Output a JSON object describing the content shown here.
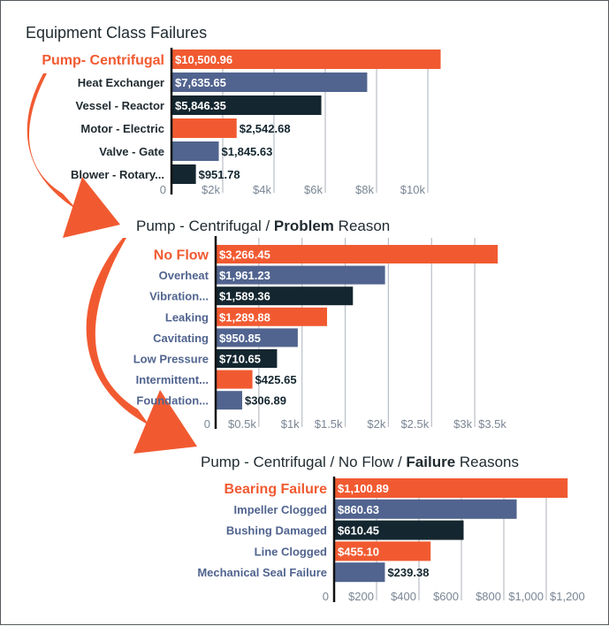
{
  "colors": {
    "orange": "#f15a31",
    "slate": "#51648f",
    "navy": "#14262f",
    "grid": "#b9bec6",
    "axis": "#111111",
    "tick_text": "#7a8694",
    "label_dark": "#1f2a30",
    "label_slate": "#51648f",
    "arrow": "#f15a31"
  },
  "chart_data": [
    {
      "type": "bar",
      "orientation": "horizontal",
      "title": "Equipment Class Failures",
      "title_parts": [
        {
          "text": "Equipment Class Failures",
          "bold": false
        }
      ],
      "categories": [
        "Pump- Centrifugal",
        "Heat Exchanger",
        "Vessel - Reactor",
        "Motor - Electric",
        "Valve - Gate",
        "Blower - Rotary..."
      ],
      "values": [
        10500.96,
        7635.65,
        5846.35,
        2542.68,
        1845.63,
        951.78
      ],
      "value_labels": [
        "$10,500.96",
        "$7,635.65",
        "$5,846.35",
        "$2,542.68",
        "$1,845.63",
        "$951.78"
      ],
      "bar_colors": [
        "orange",
        "slate",
        "navy",
        "orange",
        "slate",
        "navy"
      ],
      "highlight_index": 0,
      "label_color": "label_dark",
      "xlim": [
        0,
        10000
      ],
      "xticks": [
        0,
        2000,
        4000,
        6000,
        8000,
        10000
      ],
      "xtick_labels": [
        "0",
        "$2k",
        "$4k",
        "$6k",
        "$8k",
        "$10k"
      ],
      "grid": true,
      "xlabel": "",
      "ylabel": ""
    },
    {
      "type": "bar",
      "orientation": "horizontal",
      "title": "Pump - Centrifugal / Problem Reason",
      "title_parts": [
        {
          "text": "Pump - Centrifugal / ",
          "bold": false
        },
        {
          "text": "Problem",
          "bold": true
        },
        {
          "text": " Reason",
          "bold": false
        }
      ],
      "categories": [
        "No Flow",
        "Overheat",
        "Vibration...",
        "Leaking",
        "Cavitating",
        "Low Pressure",
        "Intermittent...",
        "Foundation..."
      ],
      "values": [
        3266.45,
        1961.23,
        1589.36,
        1289.88,
        950.85,
        710.65,
        425.65,
        306.89
      ],
      "value_labels": [
        "$3,266.45",
        "$1,961.23",
        "$1,589.36",
        "$1,289.88",
        "$950.85",
        "$710.65",
        "$425.65",
        "$306.89"
      ],
      "bar_colors": [
        "orange",
        "slate",
        "navy",
        "orange",
        "slate",
        "navy",
        "orange",
        "slate"
      ],
      "highlight_index": 0,
      "label_color": "label_slate",
      "xlim": [
        0,
        3000
      ],
      "xticks": [
        0,
        500,
        1000,
        1500,
        2000,
        2500,
        3000,
        3500
      ],
      "xtick_labels": [
        "0",
        "$0.5k",
        "$1k",
        "$1.5k",
        "$2k",
        "$2.5k",
        "$3k",
        "$3.5k"
      ],
      "grid": true,
      "xlabel": "",
      "ylabel": ""
    },
    {
      "type": "bar",
      "orientation": "horizontal",
      "title": "Pump - Centrifugal / No Flow / Failure Reasons",
      "title_parts": [
        {
          "text": "Pump - Centrifugal / No Flow / ",
          "bold": false
        },
        {
          "text": "Failure",
          "bold": true
        },
        {
          "text": " Reasons",
          "bold": false
        }
      ],
      "categories": [
        "Bearing Failure",
        "Impeller Clogged",
        "Bushing Damaged",
        "Line Clogged",
        "Mechanical Seal Failure"
      ],
      "values": [
        1100.89,
        860.63,
        610.45,
        455.1,
        239.38
      ],
      "value_labels": [
        "$1,100.89",
        "$860.63",
        "$610.45",
        "$455.10",
        "$239.38"
      ],
      "bar_colors": [
        "orange",
        "slate",
        "navy",
        "orange",
        "slate"
      ],
      "highlight_index": 0,
      "label_color": "label_slate",
      "xlim": [
        0,
        1000
      ],
      "xticks": [
        0,
        200,
        400,
        600,
        800,
        1000,
        1200
      ],
      "xtick_labels": [
        "0",
        "$200",
        "$400",
        "$600",
        "$800",
        "$1,000",
        "$1,200"
      ],
      "grid": true,
      "xlabel": "",
      "ylabel": ""
    }
  ],
  "annotations": [
    {
      "type": "arrow",
      "from": "Pump- Centrifugal",
      "to": "Pump - Centrifugal / Problem Reason"
    },
    {
      "type": "arrow",
      "from": "No Flow",
      "to": "Pump - Centrifugal / No Flow / Failure Reasons"
    }
  ]
}
